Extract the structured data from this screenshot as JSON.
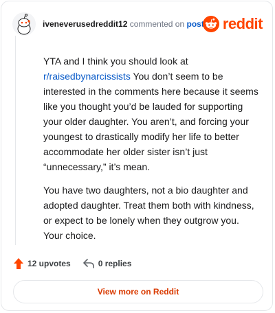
{
  "header": {
    "author": "iveneverusedreddit12",
    "action_text": "commented on",
    "post_link_label": "post",
    "logo_text": "reddit"
  },
  "comment": {
    "p1_before": "YTA and I think you should look at",
    "subreddit_link": "r/raisedbynarcissists",
    "p1_after": "You don’t seem to be interested in the comments here because it seems like you thought you’d be lauded for supporting your older daughter. You aren’t, and forcing your youngest to drastically modify her life to better accommodate her older sister isn’t just “unnecessary,” it’s mean.",
    "p2": "You have two daughters, not a bio daughter and adopted daughter. Treat them both with kindness, or expect to be lonely when they outgrow you. Your choice."
  },
  "footer": {
    "upvotes_label": "12 upvotes",
    "replies_label": "0 replies"
  },
  "cta": {
    "view_more_label": "View more on Reddit"
  },
  "colors": {
    "brand": "#ff4500",
    "link": "#0b5cc9",
    "cta_text": "#d93a00"
  },
  "icons": [
    "reddit-avatar-icon",
    "reddit-snoo-icon",
    "upvote-arrow-icon",
    "reply-arrow-icon"
  ]
}
